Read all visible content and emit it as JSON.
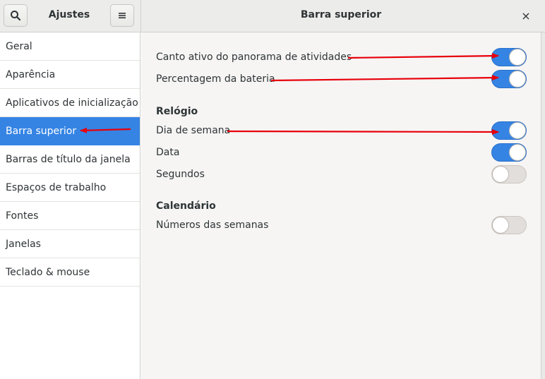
{
  "header": {
    "left_title": "Ajustes",
    "right_title": "Barra superior",
    "close_glyph": "×",
    "search_icon": "search-icon",
    "menu_icon": "hamburger-menu-icon"
  },
  "sidebar": {
    "items": [
      {
        "label": "Geral"
      },
      {
        "label": "Aparência"
      },
      {
        "label": "Aplicativos de inicialização"
      },
      {
        "label": "Barra superior"
      },
      {
        "label": "Barras de título da janela"
      },
      {
        "label": "Espaços de trabalho"
      },
      {
        "label": "Fontes"
      },
      {
        "label": "Janelas"
      },
      {
        "label": "Teclado & mouse"
      }
    ],
    "active_index": 3
  },
  "settings": {
    "hot_corner": {
      "label": "Canto ativo do panorama de atividades",
      "enabled": true
    },
    "battery_percentage": {
      "label": "Percentagem da bateria",
      "enabled": true
    },
    "clock_section": "Relógio",
    "weekday": {
      "label": "Dia de semana",
      "enabled": true
    },
    "date": {
      "label": "Data",
      "enabled": true
    },
    "seconds": {
      "label": "Segundos",
      "enabled": false
    },
    "calendar_section": "Calendário",
    "week_numbers": {
      "label": "Números das semanas",
      "enabled": false
    }
  },
  "colors": {
    "accent": "#3584e4",
    "annotation_arrow": "#e8000b"
  }
}
